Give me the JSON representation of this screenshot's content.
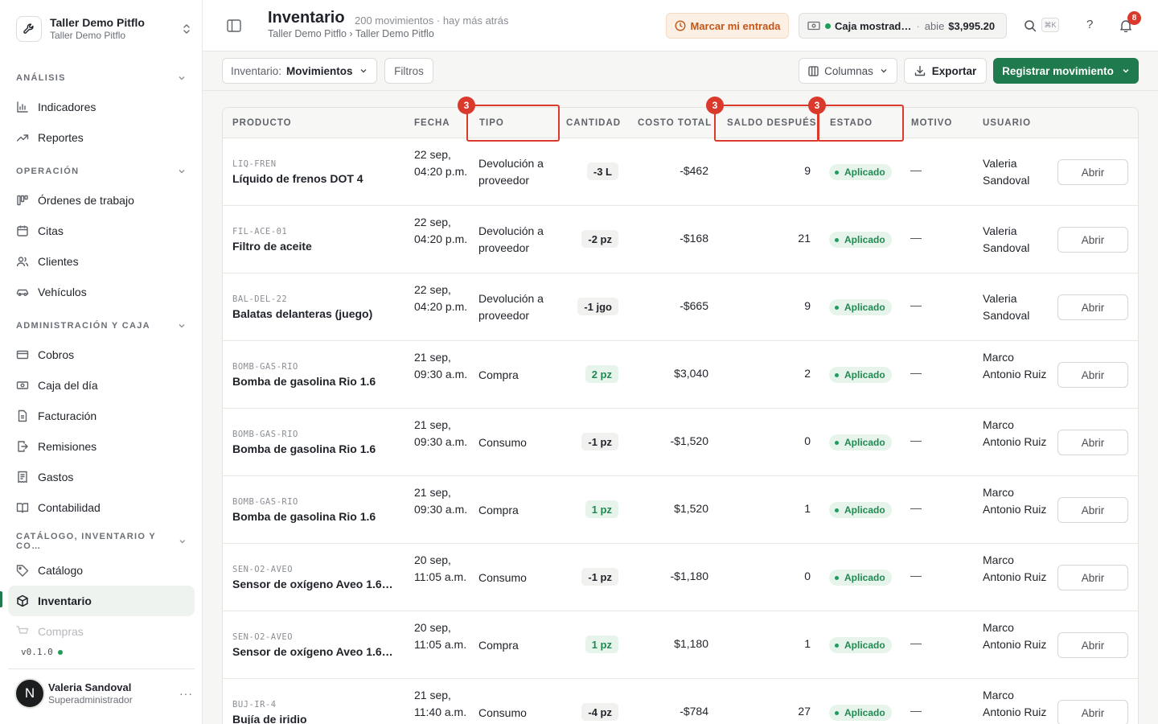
{
  "workspace": {
    "name": "Taller Demo Pitflo",
    "sub": "Taller Demo Pitflo"
  },
  "nav": {
    "sections": [
      {
        "label": "ANÁLISIS",
        "items": [
          "Indicadores",
          "Reportes"
        ]
      },
      {
        "label": "OPERACIÓN",
        "items": [
          "Órdenes de trabajo",
          "Citas",
          "Clientes",
          "Vehículos"
        ]
      },
      {
        "label": "ADMINISTRACIÓN Y CAJA",
        "items": [
          "Cobros",
          "Caja del día",
          "Facturación",
          "Remisiones",
          "Gastos",
          "Contabilidad"
        ]
      },
      {
        "label": "CATÁLOGO, INVENTARIO Y CO…",
        "items": [
          "Catálogo",
          "Inventario",
          "Compras"
        ]
      }
    ],
    "active_item": "Inventario"
  },
  "version": "v0.1.0",
  "user": {
    "initial": "N",
    "name": "Valeria Sandoval",
    "role": "Superadministrador",
    "more": "···"
  },
  "header": {
    "title": "Inventario",
    "meta": "200 movimientos · hay más atrás",
    "breadcrumb": "Taller Demo Pitflo › Taller Demo Pitflo",
    "entry_button": "Marcar mi entrada",
    "cash": {
      "name": "Caja mostrad…",
      "sep": "·",
      "state": "abie",
      "amount": "$3,995.20"
    },
    "shortcut": "⌘K",
    "help": "?",
    "notifications": "8"
  },
  "toolbar": {
    "view_label": "Inventario:",
    "view_value": "Movimientos",
    "filters": "Filtros",
    "columns": "Columnas",
    "export": "Exportar",
    "primary": "Registrar movimiento"
  },
  "table": {
    "columns": [
      "PRODUCTO",
      "FECHA",
      "TIPO",
      "CANTIDAD",
      "COSTO TOTAL",
      "SALDO DESPUÉS",
      "ESTADO",
      "MOTIVO",
      "USUARIO"
    ],
    "open_label": "Abrir",
    "rows": [
      {
        "sku": "LIQ-FREN",
        "product": "Líquido de frenos DOT 4",
        "date": "22 sep, 04:20 p.m.",
        "type": "Devolución a proveedor",
        "qty": "-3 L",
        "qty_sign": "neg",
        "cost": "-$462",
        "balance": "9",
        "status": "Aplicado",
        "reason": "—",
        "user": "Valeria Sandoval"
      },
      {
        "sku": "FIL-ACE-01",
        "product": "Filtro de aceite",
        "date": "22 sep, 04:20 p.m.",
        "type": "Devolución a proveedor",
        "qty": "-2 pz",
        "qty_sign": "neg",
        "cost": "-$168",
        "balance": "21",
        "status": "Aplicado",
        "reason": "—",
        "user": "Valeria Sandoval"
      },
      {
        "sku": "BAL-DEL-22",
        "product": "Balatas delanteras (juego)",
        "date": "22 sep, 04:20 p.m.",
        "type": "Devolución a proveedor",
        "qty": "-1 jgo",
        "qty_sign": "neg",
        "cost": "-$665",
        "balance": "9",
        "status": "Aplicado",
        "reason": "—",
        "user": "Valeria Sandoval"
      },
      {
        "sku": "BOMB-GAS-RIO",
        "product": "Bomba de gasolina Rio 1.6",
        "date": "21 sep, 09:30 a.m.",
        "type": "Compra",
        "qty": "2 pz",
        "qty_sign": "pos",
        "cost": "$3,040",
        "balance": "2",
        "status": "Aplicado",
        "reason": "—",
        "user": "Marco Antonio Ruiz"
      },
      {
        "sku": "BOMB-GAS-RIO",
        "product": "Bomba de gasolina Rio 1.6",
        "date": "21 sep, 09:30 a.m.",
        "type": "Consumo",
        "qty": "-1 pz",
        "qty_sign": "neg",
        "cost": "-$1,520",
        "balance": "0",
        "status": "Aplicado",
        "reason": "—",
        "user": "Marco Antonio Ruiz"
      },
      {
        "sku": "BOMB-GAS-RIO",
        "product": "Bomba de gasolina Rio 1.6",
        "date": "21 sep, 09:30 a.m.",
        "type": "Compra",
        "qty": "1 pz",
        "qty_sign": "pos",
        "cost": "$1,520",
        "balance": "1",
        "status": "Aplicado",
        "reason": "—",
        "user": "Marco Antonio Ruiz"
      },
      {
        "sku": "SEN-O2-AVEO",
        "product": "Sensor de oxígeno Aveo 1.6…",
        "date": "20 sep, 11:05 a.m.",
        "type": "Consumo",
        "qty": "-1 pz",
        "qty_sign": "neg",
        "cost": "-$1,180",
        "balance": "0",
        "status": "Aplicado",
        "reason": "—",
        "user": "Marco Antonio Ruiz"
      },
      {
        "sku": "SEN-O2-AVEO",
        "product": "Sensor de oxígeno Aveo 1.6…",
        "date": "20 sep, 11:05 a.m.",
        "type": "Compra",
        "qty": "1 pz",
        "qty_sign": "pos",
        "cost": "$1,180",
        "balance": "1",
        "status": "Aplicado",
        "reason": "—",
        "user": "Marco Antonio Ruiz"
      },
      {
        "sku": "BUJ-IR-4",
        "product": "Bujía de iridio",
        "date": "21 sep, 11:40 a.m.",
        "type": "Consumo",
        "qty": "-4 pz",
        "qty_sign": "neg",
        "cost": "-$784",
        "balance": "27",
        "status": "Aplicado",
        "reason": "—",
        "user": "Marco Antonio Ruiz"
      }
    ]
  },
  "annotations": {
    "badge": "3",
    "color": "#d93a2b"
  }
}
